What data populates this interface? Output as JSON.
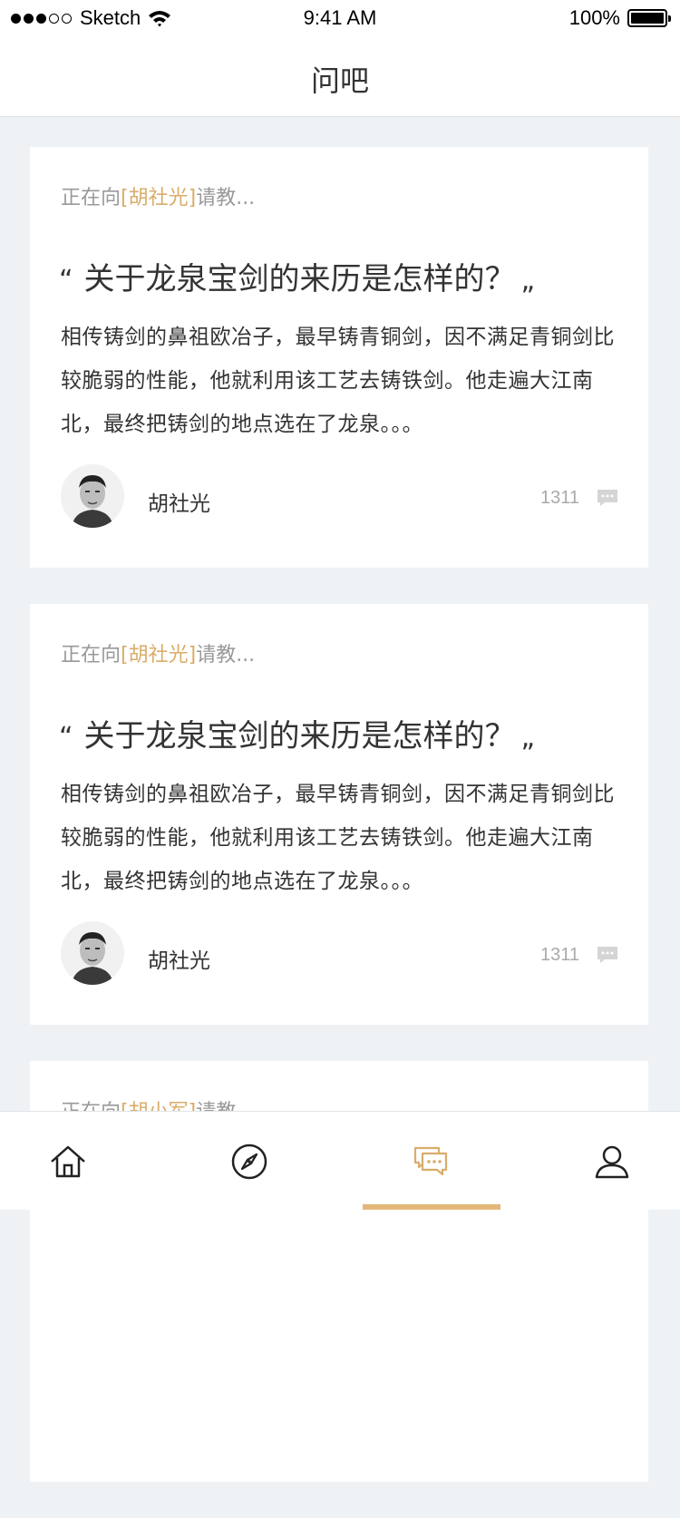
{
  "status_bar": {
    "carrier": "Sketch",
    "time": "9:41 AM",
    "battery": "100%",
    "signal_dots": [
      true,
      true,
      true,
      false,
      false
    ]
  },
  "nav": {
    "title": "问吧"
  },
  "colors": {
    "accent": "#d9ac6a",
    "background": "#eff2f5"
  },
  "cards": [
    {
      "asking_prefix": "正在向",
      "asking_name": "[胡社光]",
      "asking_suffix": "请教...",
      "quote_open": "“",
      "question": "关于龙泉宝剑的来历是怎样的？",
      "quote_close": "„",
      "excerpt": "相传铸剑的鼻祖欧冶子，最早铸青铜剑，因不满足青铜剑比较脆弱的性能，他就利用该工艺去铸铁剑。他走遍大江南北，最终把铸剑的地点选在了龙泉。。。",
      "author": "胡社光",
      "comment_count": "1311"
    },
    {
      "asking_prefix": "正在向",
      "asking_name": "[胡社光]",
      "asking_suffix": "请教...",
      "quote_open": "“",
      "question": "关于龙泉宝剑的来历是怎样的？",
      "quote_close": "„",
      "excerpt": "相传铸剑的鼻祖欧冶子，最早铸青铜剑，因不满足青铜剑比较脆弱的性能，他就利用该工艺去铸铁剑。他走遍大江南北，最终把铸剑的地点选在了龙泉。。。",
      "author": "胡社光",
      "comment_count": "1311"
    },
    {
      "asking_prefix": "正在向",
      "asking_name": "[胡小军]",
      "asking_suffix": "请教"
    }
  ],
  "tabs": [
    {
      "icon": "home-icon",
      "active": false
    },
    {
      "icon": "compass-icon",
      "active": false
    },
    {
      "icon": "chat-bubbles-icon",
      "active": true
    },
    {
      "icon": "user-icon",
      "active": false
    }
  ]
}
